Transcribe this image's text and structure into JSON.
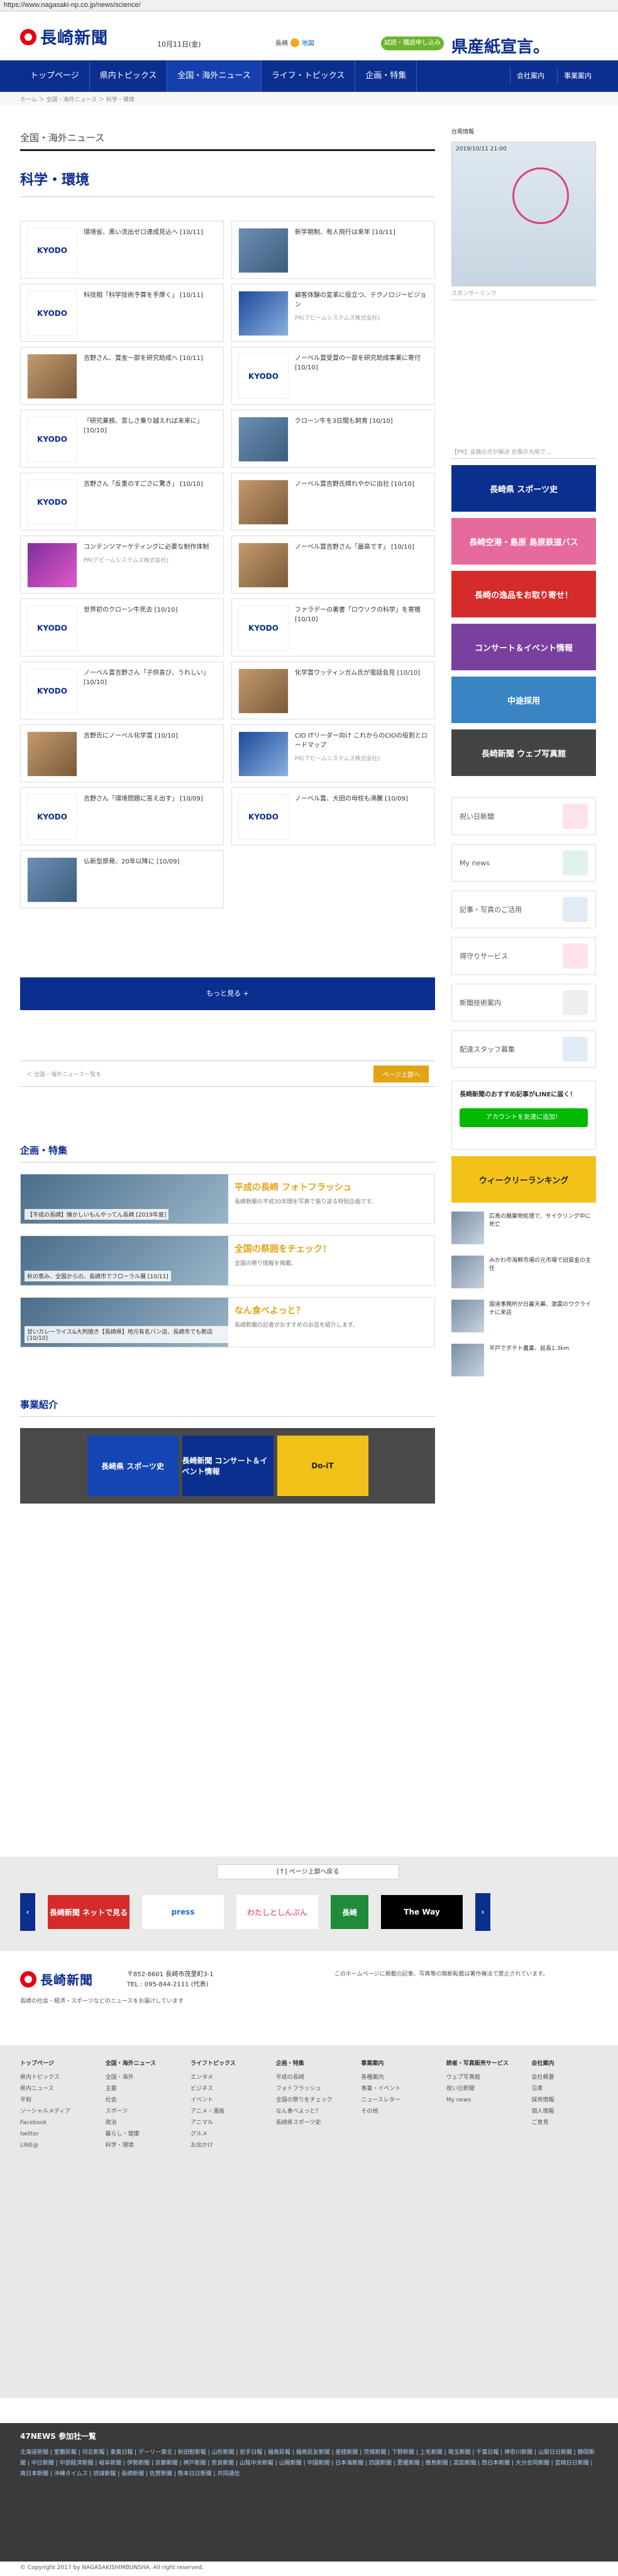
{
  "browser": {
    "url": "https://www.nagasaki-np.co.jp/news/science/"
  },
  "header": {
    "logo": "長崎新聞",
    "date": "10月11日(金)",
    "weather_area": "長崎",
    "weather_link": "地図",
    "trial_button": "試読・購読申し込み",
    "ad": "県産紙宣言。"
  },
  "nav": {
    "items": [
      "トップページ",
      "県内トピックス",
      "全国・海外ニュース",
      "ライフ・トピックス",
      "企画・特集"
    ],
    "right": [
      "会社案内",
      "事業案内"
    ]
  },
  "breadcrumb": "ホーム ＞ 全国・海外ニュース ＞ 科学・環境",
  "main": {
    "section_title": "全国・海外ニュース",
    "sub_title": "科学・環境",
    "articles": [
      {
        "title": "環境省、黒い流出ゼロ達成見込へ [10/11]",
        "thumb": "KYODO"
      },
      {
        "title": "新学期制、有人飛行は来年 [10/11]",
        "thumb": "img"
      },
      {
        "title": "科技相「科学技術予算を手厚く」 [10/11]",
        "thumb": "KYODO"
      },
      {
        "title": "顧客体験の変革に役立つ、テクノロジービジョン",
        "thumb": "img3",
        "source": "PR(アビームシステムズ株式会社)"
      },
      {
        "title": "吉野さん、賞金一部を研究助成へ [10/11]",
        "thumb": "img2"
      },
      {
        "title": "ノーベル賞受賞の一部を研究助成事業に寄付 [10/10]",
        "thumb": "KYODO"
      },
      {
        "title": "「研究業務、苦しさ乗り越えれば未来に」 [10/10]",
        "thumb": "KYODO"
      },
      {
        "title": "クローン牛を3日間も飼育 [10/10]",
        "thumb": "img"
      },
      {
        "title": "吉野さん「反重のすごさに驚き」 [10/10]",
        "thumb": "KYODO"
      },
      {
        "title": "ノーベル賞吉野氏晴れやかに出社 [10/10]",
        "thumb": "img2"
      },
      {
        "title": "コンテンツマーケティングに必要な制作体制",
        "thumb": "img4",
        "source": "PR(アビームシステムズ株式会社)"
      },
      {
        "title": "ノーベル賞吉野さん「最高です」 [10/10]",
        "thumb": "img2"
      },
      {
        "title": "世界初のクローン牛死去 [10/10]",
        "thumb": "KYODO"
      },
      {
        "title": "ファラデーの著書「ロウソクの科学」を寄贈 [10/10]",
        "thumb": "KYODO"
      },
      {
        "title": "ノーベル賞吉野さん「子供喜び、うれしい」 [10/10]",
        "thumb": "KYODO"
      },
      {
        "title": "化学賞ウッティンガム氏が電話会見 [10/10]",
        "thumb": "img2"
      },
      {
        "title": "吉野氏にノーベル化学賞 [10/10]",
        "thumb": "img2"
      },
      {
        "title": "CIO ITリーダー向け これからのCIOの役割とロードマップ",
        "thumb": "img3",
        "source": "PR(アビームシステムズ株式会社)"
      },
      {
        "title": "吉野さん「環境問題に答え出す」 [10/09]",
        "thumb": "KYODO"
      },
      {
        "title": "ノーベル賞、大田の母校も沸騰 [10/09]",
        "thumb": "KYODO"
      },
      {
        "title": "仏新型原発、20年以降に [10/09]",
        "thumb": "img"
      }
    ],
    "more_button": "もっと見る +",
    "pager_text": "＜ 全国・海外ニュース一覧を",
    "top_button": "ページ上部へ",
    "feature_title": "企画・特集",
    "features": [
      {
        "caption": "【平成の長崎】懐かしいもんやってん長崎 [2019年度]",
        "title": "平成の長崎 フォトフラッシュ",
        "text": "長崎新聞の平成30年間を写真で振り返る特別企画です。"
      },
      {
        "caption": "秋の恵み、全国からの、長崎市でフローラル展 [10/11]",
        "title": "全国の祭囲をチェック！",
        "text": "全国の祭り情報を掲載。"
      },
      {
        "caption": "甘いカレーライス&大判焼き【長崎県】地元有名パン店、長崎市でも新店 [10/10]",
        "title": "なん食べよっと？",
        "text": "長崎新聞の記者がおすすめのお店を紹介します。"
      }
    ],
    "business_title": "事業紹介",
    "carousel": [
      "長崎県 スポーツ史",
      "長崎新聞 コンサート＆イベント情報",
      "Do-iT"
    ]
  },
  "sidebar": {
    "map_title": "台風情報",
    "map_time": "2019/10/11 21:00",
    "sponsor_link": "スポンサーリンク",
    "sponsor_text": "【PR】会員の方が解決 台風の大雨で...",
    "ads": [
      "長崎県 スポーツ史",
      "長崎空港・島原 島原鉄道バス",
      "長崎の逸品をお取り寄せ！",
      "コンサート＆イベント情報",
      "中途採用",
      "長崎新聞 ウェブ写真館"
    ],
    "links": [
      "祝い日新聞",
      "My news",
      "記事・写真のご活用",
      "得守りサービス",
      "新聞技術案内",
      "配達スタッフ募集"
    ],
    "line_title": "長崎新聞のおすすめ記事がLINEに届く！",
    "line_button": "アカウントを友達に追加！",
    "news": [
      "広島の廃棄物処理で、サイクリング中に死亡",
      "みかわ市海鮮市場の元市場で旧賃金の主任",
      "国道事務所が日暮天幕、激震のウクライナに来店",
      "平戸でポテト農業、延長1.3km"
    ]
  },
  "band": {
    "top_link": "[↑] ページ上部へ戻る",
    "banners": [
      "長崎新聞 ネットで見る",
      "press",
      "わたしとしんぶん",
      "長崎",
      "The Way"
    ]
  },
  "footer": {
    "logo": "長崎新聞",
    "address": "〒852-8601 長崎市茂里町3-1",
    "tel": "TEL : 095-844-2111 (代表)",
    "tagline": "長崎の社会・経済・スポーツなどのニュースをお届けしています",
    "note": "このホームページに掲載の記事、写真等の無断転載は著作権法で禁止されています。",
    "cols": [
      {
        "title": "トップページ",
        "items": [
          "県内トピックス",
          "県内ニュース",
          "平和",
          "ソーシャルメディア",
          "Facebook",
          "twitter",
          "LINE@"
        ]
      },
      {
        "title": "全国・海外ニュース",
        "items": [
          "全国・海外",
          "主要",
          "社会",
          "スポーツ",
          "政治",
          "暮らし・健康",
          "科学・環境"
        ]
      },
      {
        "title": "ライフトピックス",
        "items": [
          "エンタメ",
          "ビジネス",
          "イベント",
          "アニメ・漫画",
          "アニマル",
          "グルメ",
          "お出かけ"
        ]
      },
      {
        "title": "企画・特集",
        "items": [
          "平成の長崎",
          "フォトフラッシュ",
          "全国の祭りをチェック",
          "なん食べよっと？",
          "長崎県スポーツ史"
        ]
      },
      {
        "title": "事業案内",
        "items": [
          "各種案内",
          "事業・イベント",
          "ニュースレター",
          "その他"
        ]
      },
      {
        "title": "読者・写真販売サービス",
        "items": [
          "ウェブ写真館",
          "祝い日新聞",
          "My news"
        ]
      },
      {
        "title": "会社案内",
        "items": [
          "会社概要",
          "沿革",
          "採用情報",
          "個人情報",
          "ご意見"
        ]
      }
    ]
  },
  "news47": {
    "title": "47NEWS 参加社一覧",
    "list": "北海道新聞 | 室蘭民報 | 河北新報 | 東奥日報 | デーリー東北 | 秋田魁新報 | 山形新聞 | 岩手日報 | 福島民報 | 福島民友新聞 | 産経新聞 | 茨城新聞 | 下野新聞 | 上毛新聞 | 埼玉新聞 | 千葉日報 | 神奈川新聞 | 山梨日日新聞 | 静岡新聞 | 中日新聞 | 中部経済新聞 | 岐阜新聞 | 伊勢新聞 | 京都新聞 | 神戸新聞 | 奈良新聞 | 山陰中央新報 | 山陽新聞 | 中国新聞 | 日本海新聞 | 四国新聞 | 愛媛新聞 | 徳島新聞 | 高知新聞 | 西日本新聞 | 大分合同新聞 | 宮崎日日新聞 | 南日本新聞 | 沖縄タイムス | 琉球新報 | 長崎新聞 | 佐賀新聞 | 熊本日日新聞 | 共同通信"
  },
  "copyright": "© Copyright 2017 by NAGASAKISHIMBUNSHA. All right reserved."
}
